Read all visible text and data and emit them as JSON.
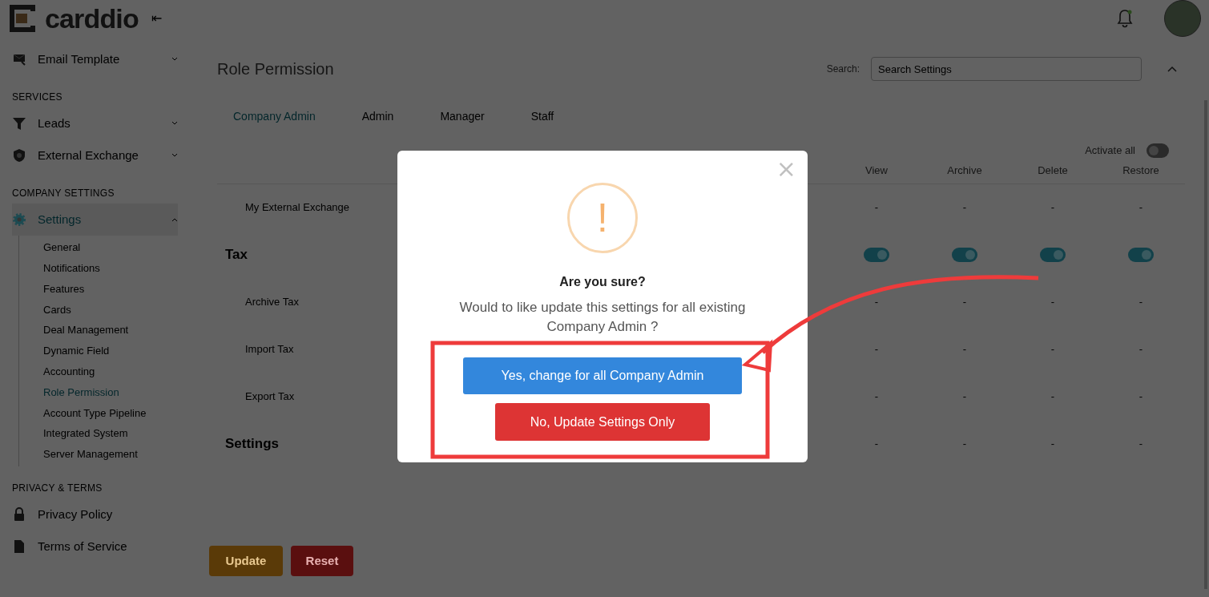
{
  "brand": {
    "name": "carddio",
    "collapse_glyph": "⇤"
  },
  "sidebar": {
    "items": [
      {
        "kind": "link",
        "label": "Email Template",
        "chevron": true,
        "selected": false
      },
      {
        "kind": "heading",
        "label": "SERVICES"
      },
      {
        "kind": "link",
        "label": "Leads",
        "chevron": true,
        "selected": false
      },
      {
        "kind": "link",
        "label": "External Exchange",
        "chevron": true,
        "selected": false
      },
      {
        "kind": "heading",
        "label": "COMPANY SETTINGS"
      },
      {
        "kind": "link",
        "label": "Settings",
        "chevron": true,
        "selected": true,
        "expanded": true,
        "children": [
          {
            "label": "General",
            "selected": false
          },
          {
            "label": "Notifications",
            "selected": false
          },
          {
            "label": "Features",
            "selected": false
          },
          {
            "label": "Cards",
            "selected": false
          },
          {
            "label": "Deal Management",
            "selected": false
          },
          {
            "label": "Dynamic Field",
            "selected": false
          },
          {
            "label": "Accounting",
            "selected": false
          },
          {
            "label": "Role Permission",
            "selected": true
          },
          {
            "label": "Account Type Pipeline",
            "selected": false
          },
          {
            "label": "Integrated System",
            "selected": false
          },
          {
            "label": "Server Management",
            "selected": false
          }
        ]
      },
      {
        "kind": "heading",
        "label": "PRIVACY & TERMS"
      },
      {
        "kind": "link",
        "label": "Privacy Policy",
        "chevron": false,
        "selected": false
      },
      {
        "kind": "link",
        "label": "Terms of Service",
        "chevron": false,
        "selected": false
      }
    ]
  },
  "page": {
    "title": "Role Permission",
    "search_label": "Search:",
    "search_placeholder": "Search Settings"
  },
  "tabs": [
    {
      "label": "Company Admin",
      "selected": true
    },
    {
      "label": "Admin",
      "selected": false
    },
    {
      "label": "Manager",
      "selected": false
    },
    {
      "label": "Staff",
      "selected": false
    }
  ],
  "activate_all": {
    "label": "Activate all",
    "on": false
  },
  "table": {
    "columns": [
      "View",
      "Archive",
      "Delete",
      "Restore"
    ],
    "rows": [
      {
        "kind": "item",
        "label": "My External Exchange",
        "cells": [
          {
            "kind": "text",
            "text": "-"
          },
          {
            "kind": "text",
            "text": "-"
          },
          {
            "kind": "text",
            "text": "-"
          },
          {
            "kind": "text",
            "text": "-"
          }
        ]
      },
      {
        "kind": "section",
        "label": "Tax",
        "cells": [
          {
            "kind": "toggle",
            "on": true
          },
          {
            "kind": "toggle",
            "on": true
          },
          {
            "kind": "toggle",
            "on": true
          },
          {
            "kind": "toggle",
            "on": true
          }
        ]
      },
      {
        "kind": "item",
        "label": "Archive Tax",
        "cells": [
          {
            "kind": "text",
            "text": "-"
          },
          {
            "kind": "text",
            "text": "-"
          },
          {
            "kind": "text",
            "text": "-"
          },
          {
            "kind": "text",
            "text": "-"
          }
        ]
      },
      {
        "kind": "item",
        "label": "Import Tax",
        "cells": [
          {
            "kind": "text",
            "text": "-"
          },
          {
            "kind": "text",
            "text": "-"
          },
          {
            "kind": "text",
            "text": "-"
          },
          {
            "kind": "text",
            "text": "-"
          }
        ]
      },
      {
        "kind": "item",
        "label": "Export Tax",
        "cells": [
          {
            "kind": "text",
            "text": "-"
          },
          {
            "kind": "text",
            "text": "-"
          },
          {
            "kind": "text",
            "text": "-"
          },
          {
            "kind": "text",
            "text": "-"
          }
        ]
      },
      {
        "kind": "section",
        "label": "Settings",
        "cells": [
          {
            "kind": "text",
            "text": "-"
          },
          {
            "kind": "text",
            "text": "-"
          },
          {
            "kind": "text",
            "text": "-"
          },
          {
            "kind": "text",
            "text": "-"
          }
        ]
      }
    ]
  },
  "actions": [
    "Update",
    "Reset"
  ],
  "dialog": {
    "close_glyph": "×",
    "mark": "!",
    "title": "Are you sure?",
    "message": "Would to like update this settings for all existing Company Admin ?",
    "confirm": "Yes, change for all Company Admin",
    "cancel": "No, Update Settings Only"
  }
}
